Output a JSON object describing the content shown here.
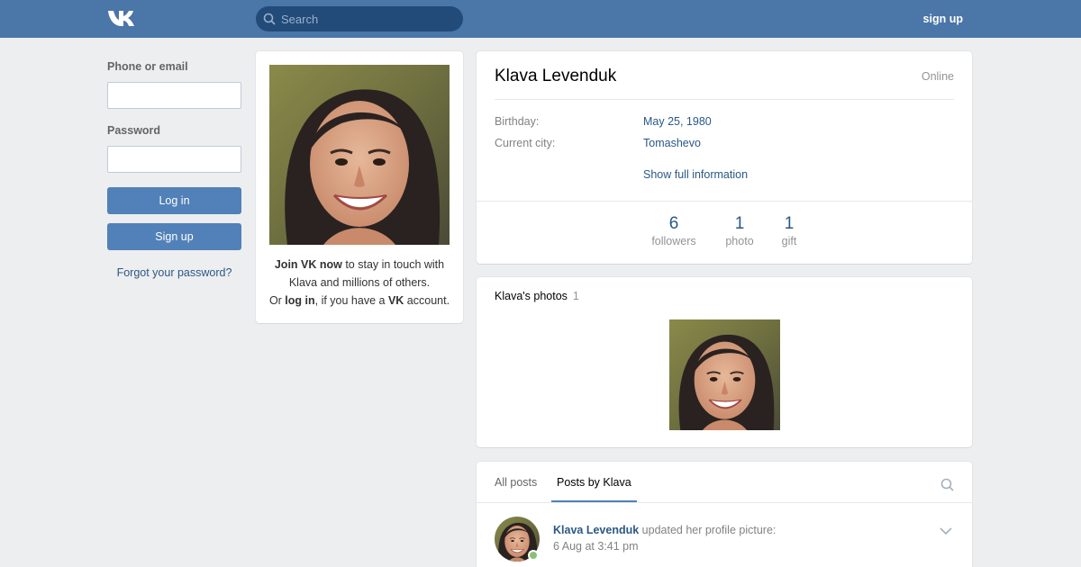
{
  "header": {
    "logo_icon": "vk-logo-icon",
    "search_placeholder": "Search",
    "signup_label": "sign up",
    "bg_color": "#4a76a8"
  },
  "login": {
    "phone_label": "Phone or email",
    "password_label": "Password",
    "login_button": "Log in",
    "signup_button": "Sign up",
    "forgot_link": "Forgot your password?"
  },
  "avatar_card": {
    "join_bold": "Join VK now",
    "join_rest": " to stay in touch with Klava and millions of others.",
    "or_text": "Or ",
    "login_bold": "log in",
    "have_text": ", if you have a ",
    "vk_bold": "VK",
    "account_text": " account."
  },
  "profile": {
    "name": "Klava Levenduk",
    "status": "Online",
    "birthday_label": "Birthday:",
    "birthday_value": "May 25, 1980",
    "city_label": "Current city:",
    "city_value": "Tomashevo",
    "show_full": "Show full information",
    "counters": [
      {
        "num": "6",
        "cap": "followers"
      },
      {
        "num": "1",
        "cap": "photo"
      },
      {
        "num": "1",
        "cap": "gift"
      }
    ]
  },
  "photos": {
    "title": "Klava's photos",
    "count": "1"
  },
  "posts": {
    "tabs": [
      "All posts",
      "Posts by Klava"
    ],
    "active_tab": "Posts by Klava",
    "post": {
      "author": "Klava Levenduk",
      "action": " updated her profile picture:",
      "date": "6 Aug at 3:41 pm"
    }
  }
}
